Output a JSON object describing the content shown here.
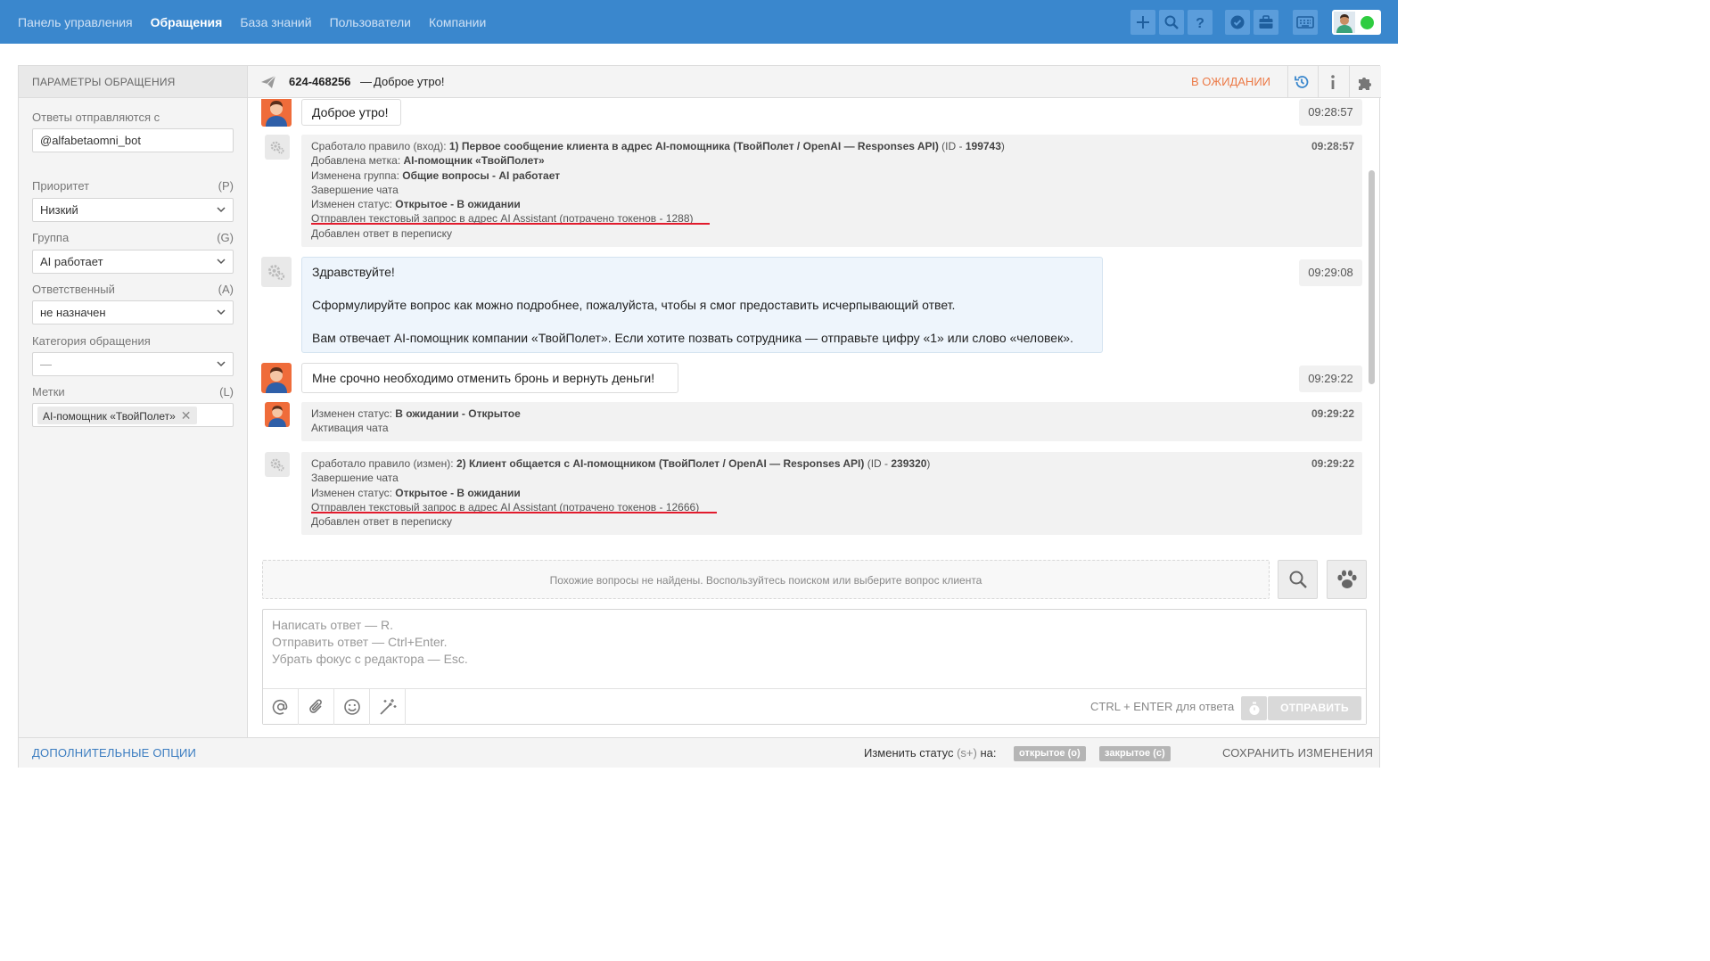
{
  "nav": {
    "items": [
      "Панель управления",
      "Обращения",
      "База знаний",
      "Пользователи",
      "Компании"
    ],
    "active_index": 1
  },
  "toolbar": {
    "icons": [
      "plus-icon",
      "search-icon",
      "help-icon",
      "check-badge-icon",
      "briefcase-icon",
      "keyboard-icon"
    ],
    "user_status_color": "#2ecc40",
    "brand_color": "#3a87cd"
  },
  "sidebar": {
    "title": "ПАРАМЕТРЫ ОБРАЩЕНИЯ",
    "sent_from_label": "Ответы отправляются с",
    "sent_from_value": "@alfabetaomni_bot",
    "priority_label": "Приоритет",
    "priority_hotkey": "(P)",
    "priority_value": "Низкий",
    "group_label": "Группа",
    "group_hotkey": "(G)",
    "group_value": "AI работает",
    "assignee_label": "Ответственный",
    "assignee_hotkey": "(A)",
    "assignee_value": "не назначен",
    "category_label": "Категория обращения",
    "category_value": "—",
    "tags_label": "Метки",
    "tags_hotkey": "(L)",
    "tag_value": "AI-помощник «ТвойПолет»"
  },
  "ticket": {
    "id": "624-468256",
    "dash": "—",
    "subject": "Доброе утро!",
    "status": "В ОЖИДАНИИ",
    "status_color": "#ec7a47"
  },
  "messages": {
    "m1_text": "Доброе утро!",
    "m1_time": "09:28:57",
    "log1": {
      "time": "09:28:57",
      "rule_prefix": "Сработало правило (вход): ",
      "rule_name": "1) Первое сообщение клиента в адрес AI-помощника (ТвойПолет / OpenAI — Responses API)",
      "rule_id_prefix": " (ID - ",
      "rule_id": "199743",
      "rule_id_suffix": ")",
      "tag_prefix": "Добавлена метка: ",
      "tag_value": "AI-помощник «ТвойПолет»",
      "group_prefix": "Изменена группа: ",
      "group_value": "Общие вопросы - AI работает",
      "chat_end": "Завершение чата",
      "status_prefix": "Изменен статус: ",
      "status_value": "Открытое - В ожидании",
      "ai_request": "Отправлен текстовый запрос в адрес AI Assistant (потрачено токенов - 1288)",
      "reply_added": "Добавлен ответ в переписку"
    },
    "m2_line1": "Здравствуйте!",
    "m2_line2": "Сформулируйте вопрос как можно подробнее, пожалуйста, чтобы я смог предоставить исчерпывающий ответ.",
    "m2_line3": "Вам отвечает AI-помощник компании «ТвойПолет». Если хотите позвать сотрудника — отправьте цифру «1» или слово «человек».",
    "m2_time": "09:29:08",
    "m3_text": "Мне срочно необходимо отменить бронь и вернуть деньги!",
    "m3_time": "09:29:22",
    "log2": {
      "time": "09:29:22",
      "status_prefix": "Изменен статус: ",
      "status_value": "В ожидании - Открытое",
      "chat_start": "Активация чата"
    },
    "log3": {
      "time": "09:29:22",
      "rule_prefix": "Сработало правило (измен): ",
      "rule_name": "2) Клиент общается с AI-помощником (ТвойПолет / OpenAI — Responses API)",
      "rule_id_prefix": " (ID - ",
      "rule_id": "239320",
      "rule_id_suffix": ")",
      "chat_end": "Завершение чата",
      "status_prefix": "Изменен статус: ",
      "status_value": "Открытое - В ожидании",
      "ai_request": "Отправлен текстовый запрос в адрес AI Assistant (потрачено токенов - 12666)",
      "reply_added": "Добавлен ответ в переписку"
    }
  },
  "suggest": {
    "text": "Похожие вопросы не найдены. Воспользуйтесь поиском или выберите вопрос клиента"
  },
  "editor": {
    "placeholder_line1": "Написать ответ — R.",
    "placeholder_line2": "Отправить ответ — Ctrl+Enter.",
    "placeholder_line3": "Убрать фокус с редактора — Esc.",
    "hint": "CTRL + ENTER для ответа",
    "send_label": "ОТПРАВИТЬ"
  },
  "footer": {
    "more_options": "ДОПОЛНИТЕЛЬНЫЕ ОПЦИИ",
    "change_status_label": "Изменить статус",
    "change_status_hotkey": "(s+)",
    "change_status_suffix": "на:",
    "status_open": "открытое (o)",
    "status_closed": "закрытое (c)",
    "save": "СОХРАНИТЬ ИЗМЕНЕНИЯ"
  }
}
